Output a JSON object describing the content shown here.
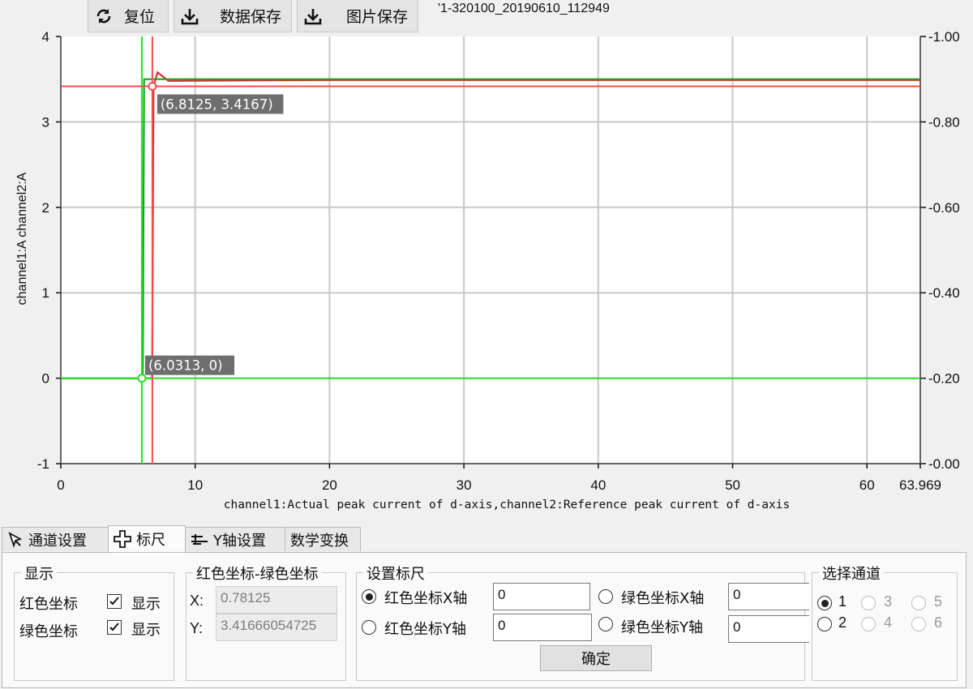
{
  "toolbar": {
    "reset_label": "复位",
    "save_data_label": "数据保存",
    "save_image_label": "图片保存",
    "file_title": "'1-320100_20190610_112949"
  },
  "chart_data": {
    "type": "line",
    "xlim": [
      0,
      63.969
    ],
    "x_ticks": [
      "0",
      "10",
      "20",
      "30",
      "40",
      "50",
      "60",
      "63.969"
    ],
    "y_left_ticks": [
      "-1",
      "0",
      "1",
      "2",
      "3",
      "4"
    ],
    "y_right_ticks": [
      "0.00",
      "0.20",
      "0.40",
      "0.60",
      "0.80",
      "1.00"
    ],
    "ylim_left": [
      -1,
      4
    ],
    "ylim_right": [
      0,
      1
    ],
    "xlabel": "channel1:Actual peak current of d-axis,channel2:Reference peak current of d-axis",
    "ylabel": "channel1:A channel2:A",
    "grid": true,
    "series": [
      {
        "name": "channel1",
        "color": "#d03030",
        "x": [
          0,
          6.8,
          6.9,
          7.2,
          8,
          20,
          40,
          63.969
        ],
        "values": [
          0,
          0,
          3.4167,
          3.58,
          3.48,
          3.49,
          3.49,
          3.49
        ]
      },
      {
        "name": "channel2",
        "color": "#20a020",
        "x": [
          0,
          6.1,
          6.15,
          6.2,
          63.969
        ],
        "values": [
          0,
          0,
          1.75,
          3.5,
          3.5
        ]
      }
    ],
    "cursors": {
      "red": {
        "x": 6.8125,
        "y": 3.4167,
        "label": "(6.8125, 3.4167)",
        "color": "#ff4a4a"
      },
      "green": {
        "x": 6.0313,
        "y": 0,
        "label": "(6.0313, 0)",
        "color": "#26e026"
      }
    }
  },
  "tabs": [
    {
      "label": "通道设置",
      "icon": "cursor-arrow-icon"
    },
    {
      "label": "标尺",
      "icon": "crosshair-icon"
    },
    {
      "label": "Y轴设置",
      "icon": "axis-settings-icon"
    },
    {
      "label": "数学变换",
      "icon": ""
    }
  ],
  "display_group": {
    "title": "显示",
    "red_label": "红色坐标",
    "red_checkbox_label": "显示",
    "red_checked": true,
    "green_label": "绿色坐标",
    "green_checkbox_label": "显示",
    "green_checked": true
  },
  "diff_group": {
    "title": "红色坐标-绿色坐标",
    "x_label": "X:",
    "x_value": "0.78125",
    "y_label": "Y:",
    "y_value": "3.41666054725"
  },
  "ruler_group": {
    "title": "设置标尺",
    "red_x_label": "红色坐标X轴",
    "red_x_value": "0",
    "red_x_selected": true,
    "red_y_label": "红色坐标Y轴",
    "red_y_value": "0",
    "green_x_label": "绿色坐标X轴",
    "green_x_value": "0",
    "green_y_label": "绿色坐标Y轴",
    "green_y_value": "0",
    "confirm_label": "确定"
  },
  "channel_group": {
    "title": "选择通道",
    "options": [
      "1",
      "2",
      "3",
      "4",
      "5",
      "6"
    ],
    "selected": "1"
  }
}
